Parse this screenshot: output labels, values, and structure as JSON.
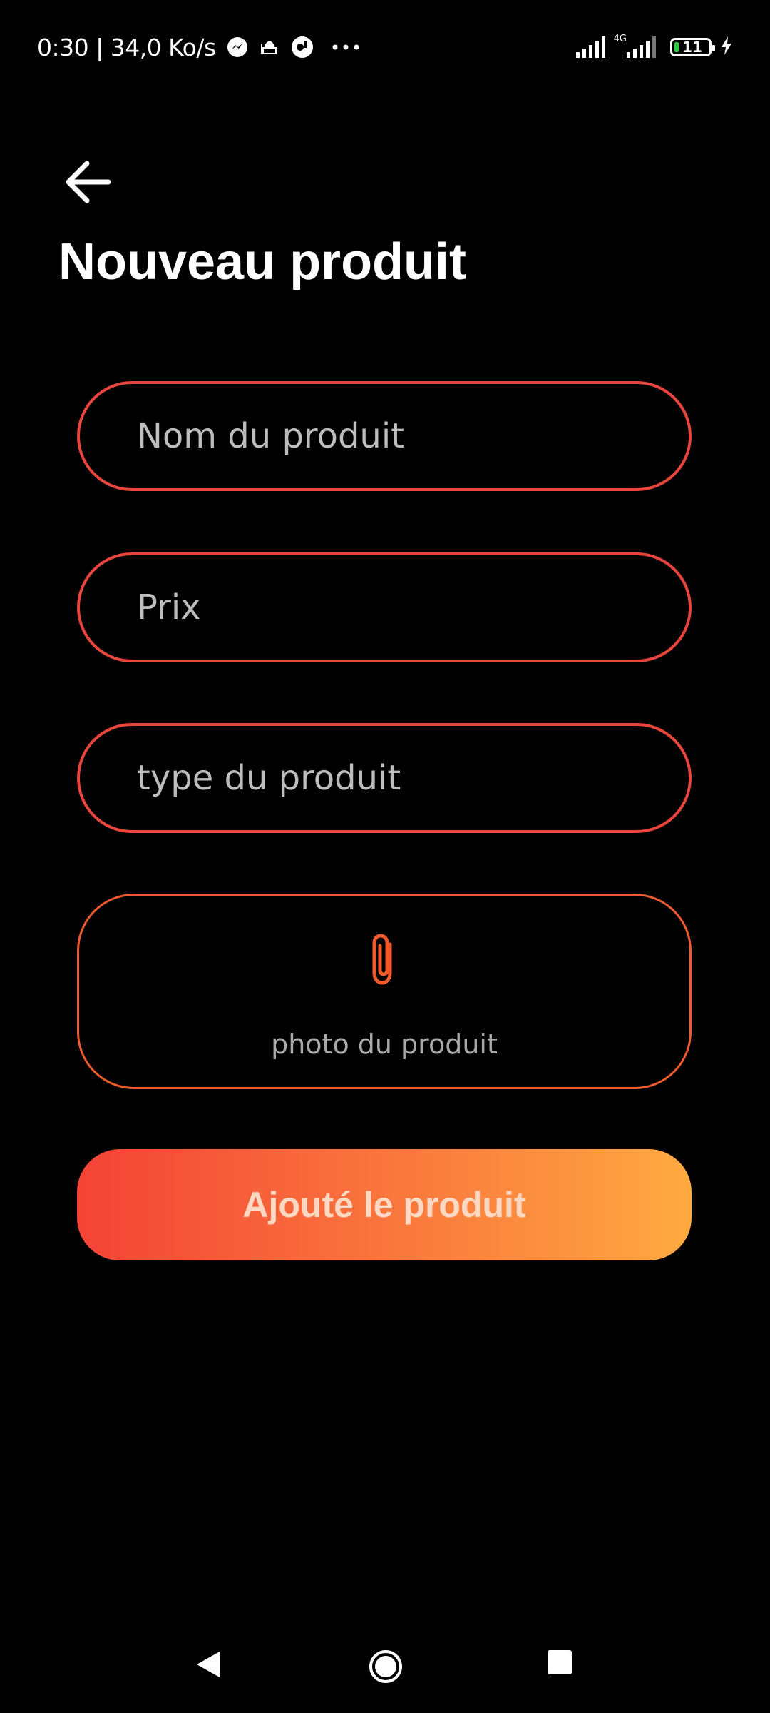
{
  "status_bar": {
    "time_speed": "0:30 | 34,0 Ko/s",
    "network_label": "4G",
    "battery_level": "11",
    "icons": [
      "messenger-icon",
      "mosque-icon",
      "app-icon",
      "more-dots-icon",
      "signal-icon",
      "signal-4g-icon",
      "battery-icon",
      "charging-bolt-icon"
    ]
  },
  "header": {
    "back_icon": "arrow-left-icon",
    "title": "Nouveau produit"
  },
  "form": {
    "name_placeholder": "Nom du produit",
    "price_placeholder": "Prix",
    "type_placeholder": "type du produit",
    "photo_icon": "paperclip-icon",
    "photo_label": "photo du produit",
    "submit_label": "Ajouté le produit"
  },
  "nav": {
    "back_icon": "nav-back-icon",
    "home_icon": "nav-home-icon",
    "recent_icon": "nav-recent-icon"
  },
  "colors": {
    "background": "#000000",
    "accent_red": "#e8453c",
    "gradient_start": "#f44336",
    "gradient_end": "#ffaa40"
  }
}
